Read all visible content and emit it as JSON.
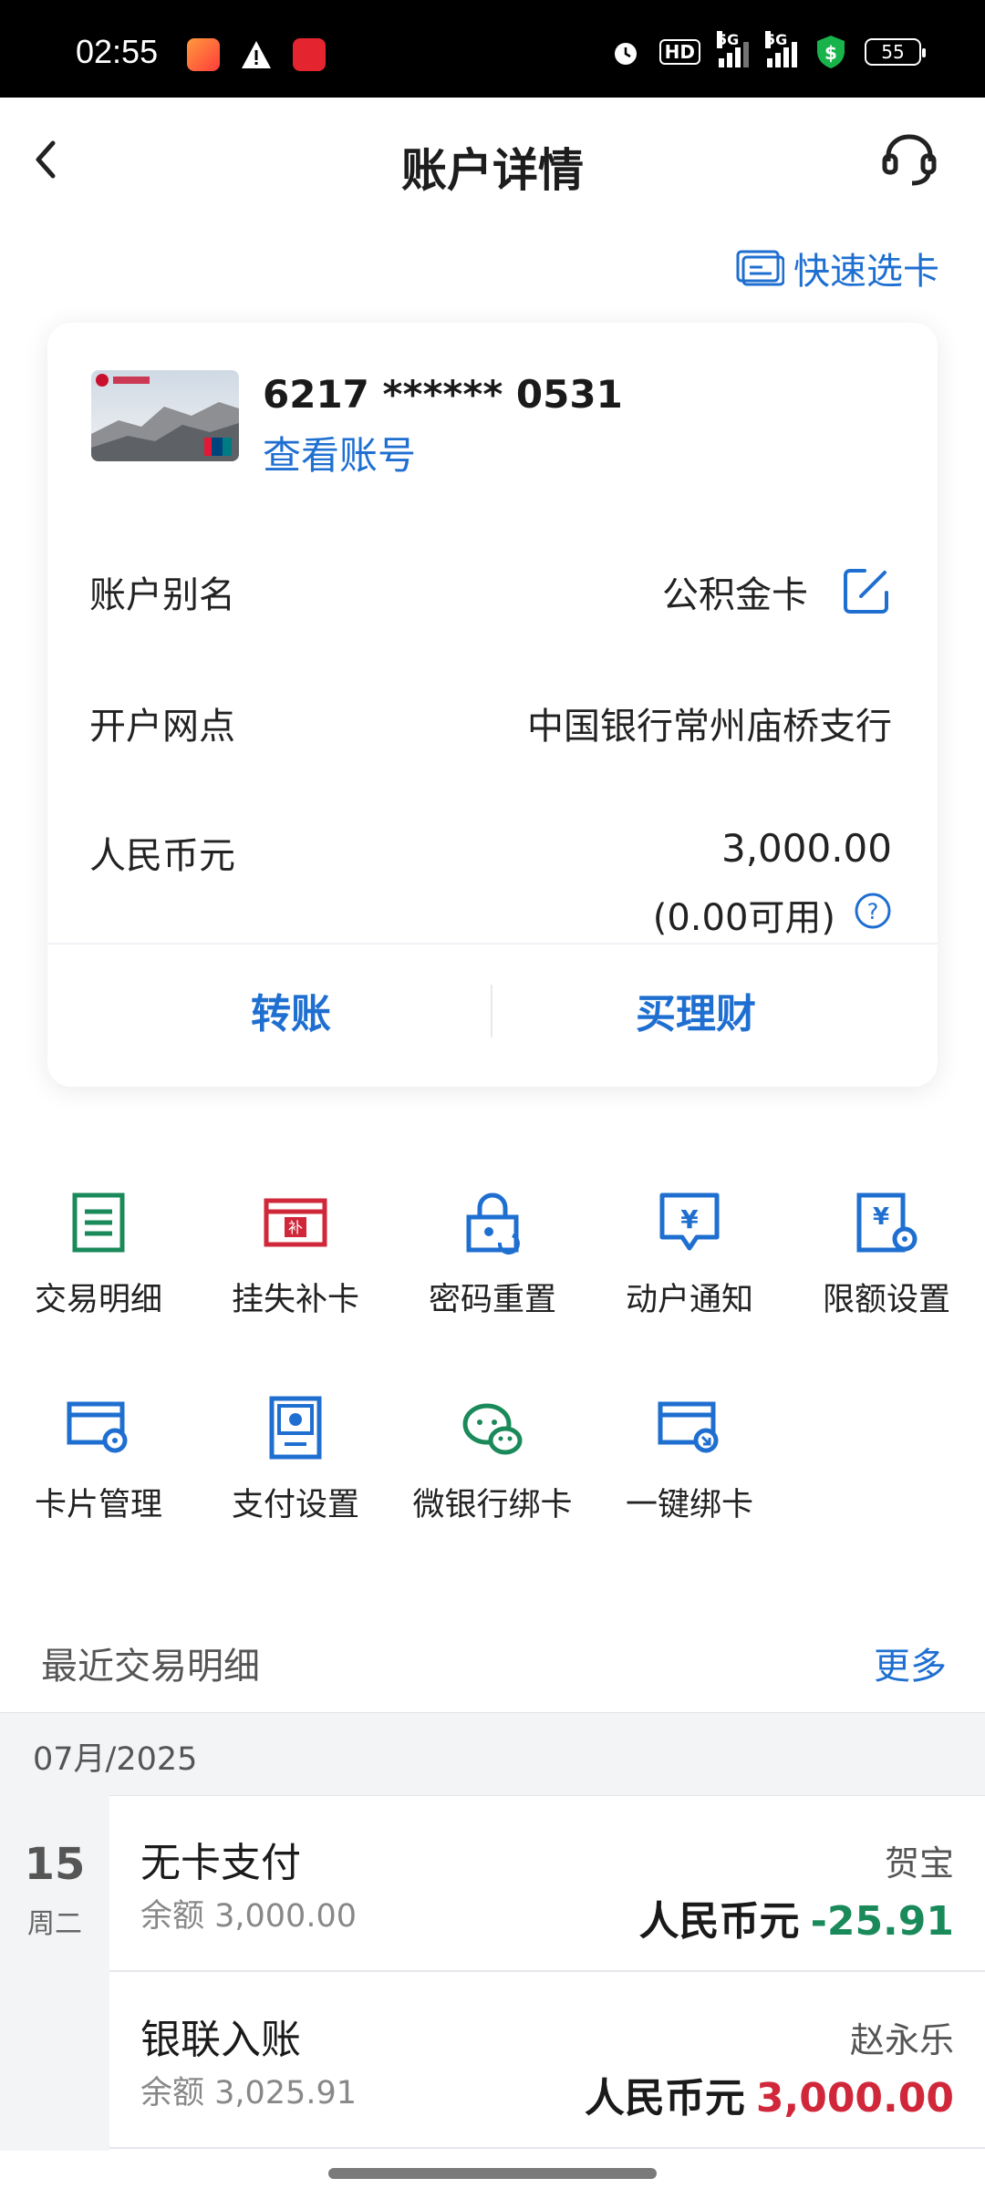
{
  "status": {
    "time": "02:55",
    "hd": "HD",
    "net1": "5G",
    "net2": "5G",
    "battery": "55"
  },
  "header": {
    "title": "账户详情"
  },
  "quick_select": "快速选卡",
  "card": {
    "number": "6217 ****** 0531",
    "view_account": "查看账号",
    "alias_label": "账户别名",
    "alias_value": "公积金卡",
    "branch_label": "开户网点",
    "branch_value": "中国银行常州庙桥支行",
    "currency_label": "人民币元",
    "balance": "3,000.00",
    "available": "(0.00可用)",
    "transfer": "转账",
    "buy_wealth": "买理财"
  },
  "functions": [
    {
      "label": "交易明细",
      "icon": "list-icon",
      "color": "#1a8a5a"
    },
    {
      "label": "挂失补卡",
      "icon": "card-report-icon",
      "color": "#d0283a"
    },
    {
      "label": "密码重置",
      "icon": "lock-reset-icon",
      "color": "#1f6fd1"
    },
    {
      "label": "动户通知",
      "icon": "yuan-notice-icon",
      "color": "#1f6fd1"
    },
    {
      "label": "限额设置",
      "icon": "limit-settings-icon",
      "color": "#1f6fd1"
    },
    {
      "label": "卡片管理",
      "icon": "card-settings-icon",
      "color": "#1f6fd1"
    },
    {
      "label": "支付设置",
      "icon": "payment-settings-icon",
      "color": "#1f6fd1"
    },
    {
      "label": "微银行绑卡",
      "icon": "wechat-bind-icon",
      "color": "#1a8a5a"
    },
    {
      "label": "一键绑卡",
      "icon": "one-click-bind-icon",
      "color": "#1f6fd1"
    }
  ],
  "recent": {
    "title": "最近交易明细",
    "more": "更多",
    "month": "07月/2025",
    "day": "15",
    "weekday": "周二",
    "transactions": [
      {
        "title": "无卡支付",
        "balance": "余额 3,000.00",
        "party": "贺宝",
        "currency": "人民币元",
        "amount": "-25.91"
      },
      {
        "title": "银联入账",
        "balance": "余额 3,025.91",
        "party": "赵永乐",
        "currency": "人民币元",
        "amount": "3,000.00"
      }
    ]
  },
  "colors": {
    "accent": "#1f6fd1",
    "negative": "#1a8a5a",
    "positive": "#d0283a"
  }
}
